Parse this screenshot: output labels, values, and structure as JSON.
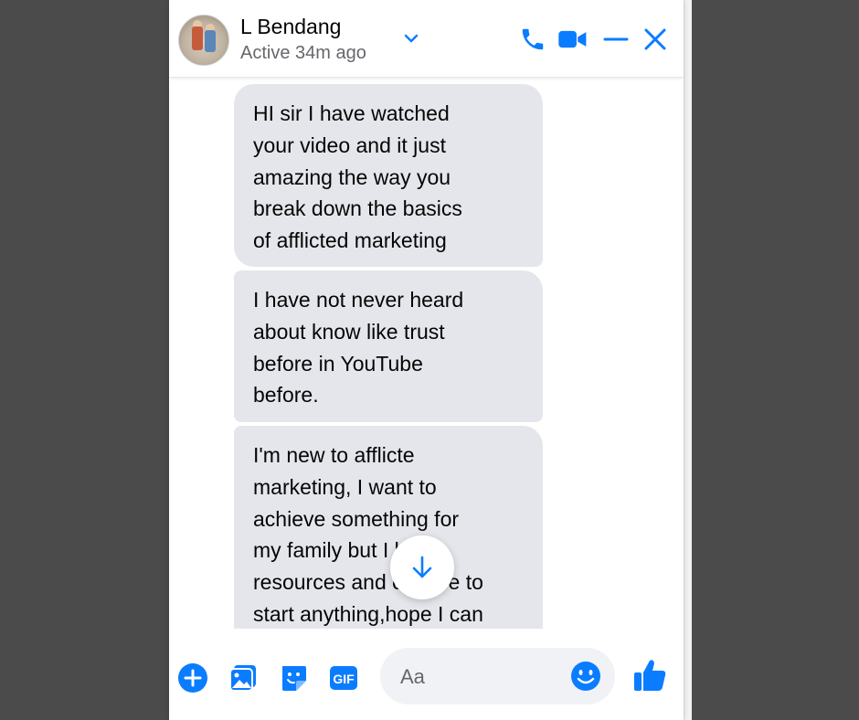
{
  "contact": {
    "name": "L Bendang",
    "status": "Active 34m ago"
  },
  "header_actions": {
    "call_icon": "phone-icon",
    "video_icon": "video-camera-icon",
    "minimize_icon": "minus-icon",
    "close_icon": "close-icon"
  },
  "messages": [
    {
      "text": "HI sir I have watched\nyour video and it just\namazing the way you\nbreak down the basics\nof afflicted marketing"
    },
    {
      "text": "I have not never heard\nabout know like trust\nbefore in YouTube\nbefore."
    },
    {
      "text": "I'm new to afflicte\nmarketing, I want to\nachieve something for\nmy family but I lack\nresources and chance to\nstart anything,hope I can"
    }
  ],
  "composer": {
    "placeholder": "Aa",
    "icons": [
      "plus-icon",
      "photo-icon",
      "sticker-icon",
      "gif-icon",
      "emoji-icon",
      "thumbs-up-icon"
    ]
  },
  "colors": {
    "accent": "#0a7cff",
    "bubble": "#e4e6eb",
    "background": "#4b4b4b"
  }
}
